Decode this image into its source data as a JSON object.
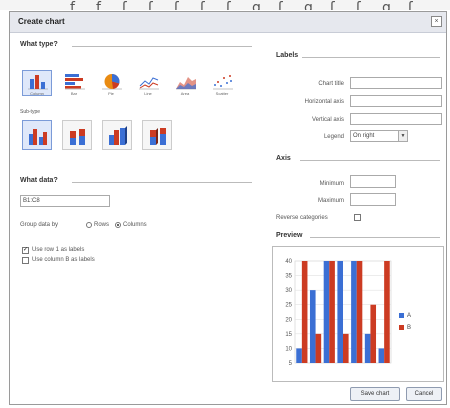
{
  "background_text": [
    "ƒ",
    "ƒ",
    "ʃ",
    "ʃ",
    "ʃ",
    "ʃ",
    "ʃ",
    "g",
    "ʃ",
    "g",
    "ʃ",
    "ʃ",
    "g",
    "ʃ"
  ],
  "dialog": {
    "title": "Create chart",
    "close_glyph": "×"
  },
  "what_type": {
    "heading": "What type?",
    "types": [
      {
        "id": "column",
        "label": "Column",
        "icon": "column-chart-icon",
        "selected": true
      },
      {
        "id": "bar",
        "label": "Bar",
        "icon": "bar-chart-icon",
        "selected": false
      },
      {
        "id": "pie",
        "label": "Pie",
        "icon": "pie-chart-icon",
        "selected": false
      },
      {
        "id": "line",
        "label": "Line",
        "icon": "line-chart-icon",
        "selected": false
      },
      {
        "id": "area",
        "label": "Area",
        "icon": "area-chart-icon",
        "selected": false
      },
      {
        "id": "scatter",
        "label": "Scatter",
        "icon": "scatter-chart-icon",
        "selected": false
      }
    ],
    "subtypes_label": "Sub-type",
    "subtypes": [
      {
        "id": "clustered",
        "icon": "clustered-column-icon",
        "selected": true
      },
      {
        "id": "stacked",
        "icon": "stacked-column-icon",
        "selected": false
      },
      {
        "id": "clustered-3d",
        "icon": "3d-clustered-column-icon",
        "selected": false
      },
      {
        "id": "stacked-3d",
        "icon": "3d-stacked-column-icon",
        "selected": false
      }
    ]
  },
  "what_data": {
    "heading": "What data?",
    "range_value": "B1:C8",
    "group_label": "Group data by",
    "group_rows": "Rows",
    "group_columns": "Columns",
    "group_selected": "columns",
    "use_row_labels": "Use row 1 as labels",
    "use_row_labels_checked": true,
    "use_col_labels": "Use column B as labels",
    "use_col_labels_checked": false
  },
  "labels": {
    "heading": "Labels",
    "chart_title": "Chart title",
    "horizontal_axis": "Horizontal axis",
    "vertical_axis": "Vertical axis",
    "legend_label": "Legend",
    "legend_value": "On right"
  },
  "axis": {
    "heading": "Axis",
    "minimum": "Minimum",
    "maximum": "Maximum",
    "reverse": "Reverse categories"
  },
  "preview": {
    "heading": "Preview"
  },
  "buttons": {
    "save": "Save chart",
    "cancel": "Cancel"
  },
  "chart_data": {
    "type": "bar",
    "categories": [
      "1",
      "2",
      "3",
      "4",
      "5",
      "6",
      "7"
    ],
    "series": [
      {
        "name": "A",
        "color": "#3b6fd4",
        "values": [
          10,
          30,
          40,
          40,
          40,
          15,
          10
        ]
      },
      {
        "name": "B",
        "color": "#cc3b22",
        "values": [
          40,
          15,
          40,
          15,
          40,
          25,
          40
        ]
      }
    ],
    "ylim": [
      5,
      40
    ],
    "yticks": [
      "5",
      "10",
      "15",
      "20",
      "25",
      "30",
      "35",
      "40"
    ],
    "legend_position": "right"
  }
}
